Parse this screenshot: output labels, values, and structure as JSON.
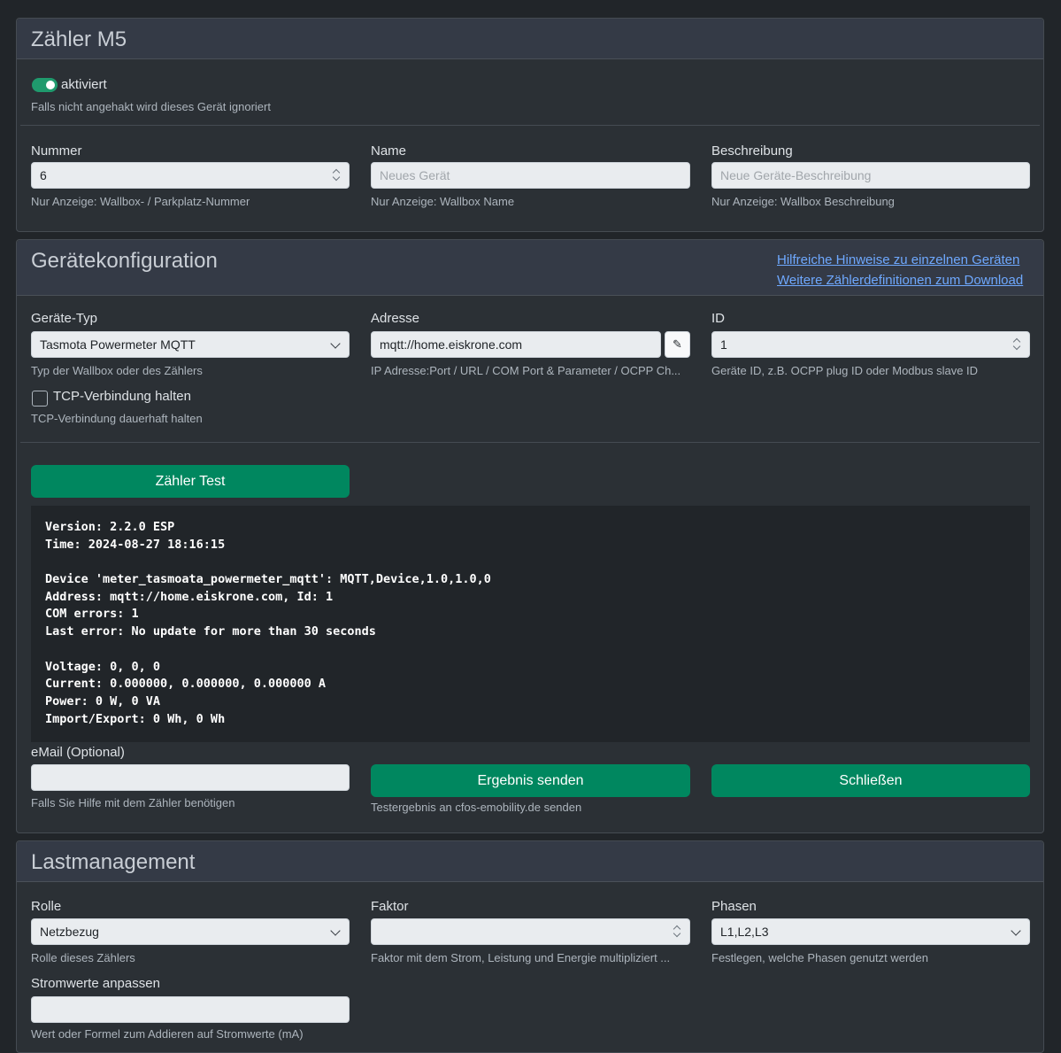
{
  "card1": {
    "title": "Zähler M5",
    "toggle_label": "aktiviert",
    "toggle_help": "Falls nicht angehakt wird dieses Gerät ignoriert",
    "nummer": {
      "label": "Nummer",
      "value": "6",
      "help": "Nur Anzeige: Wallbox- / Parkplatz-Nummer"
    },
    "name": {
      "label": "Name",
      "placeholder": "Neues Gerät",
      "help": "Nur Anzeige: Wallbox Name"
    },
    "beschreibung": {
      "label": "Beschreibung",
      "placeholder": "Neue Geräte-Beschreibung",
      "help": "Nur Anzeige: Wallbox Beschreibung"
    }
  },
  "card2": {
    "title": "Gerätekonfiguration",
    "link1": "Hilfreiche Hinweise zu einzelnen Geräten",
    "link2": "Weitere Zählerdefinitionen zum Download",
    "typ": {
      "label": "Geräte-Typ",
      "value": "Tasmota Powermeter MQTT",
      "help": "Typ der Wallbox oder des Zählers"
    },
    "adresse": {
      "label": "Adresse",
      "value": "mqtt://home.eiskrone.com",
      "help": "IP Adresse:Port / URL / COM Port & Parameter / OCPP Ch...",
      "edit_icon": "✎"
    },
    "id": {
      "label": "ID",
      "value": "1",
      "help": "Geräte ID, z.B. OCPP plug ID oder Modbus slave ID"
    },
    "tcp": {
      "label": "TCP-Verbindung halten",
      "help": "TCP-Verbindung dauerhaft halten"
    },
    "test_button": "Zähler Test",
    "console": [
      "Version: 2.2.0 ESP",
      "Time: 2024-08-27 18:16:15",
      "",
      "Device 'meter_tasmoata_powermeter_mqtt': MQTT,Device,1.0,1.0,0",
      "Address: mqtt://home.eiskrone.com, Id: 1",
      "COM errors: 1",
      "Last error: No update for more than 30 seconds",
      "",
      "Voltage: 0, 0, 0",
      "Current: 0.000000, 0.000000, 0.000000 A",
      "Power: 0 W, 0 VA",
      "Import/Export: 0 Wh, 0 Wh"
    ],
    "email": {
      "label": "eMail (Optional)",
      "value": "",
      "help": "Falls Sie Hilfe mit dem Zähler benötigen"
    },
    "send_button": "Ergebnis senden",
    "send_help": "Testergebnis an cfos-emobility.de senden",
    "close_button": "Schließen"
  },
  "card3": {
    "title": "Lastmanagement",
    "rolle": {
      "label": "Rolle",
      "value": "Netzbezug",
      "help": "Rolle dieses Zählers"
    },
    "faktor": {
      "label": "Faktor",
      "value": "",
      "help": "Faktor mit dem Strom, Leistung und Energie multipliziert ..."
    },
    "phasen": {
      "label": "Phasen",
      "value": "L1,L2,L3",
      "help": "Festlegen, welche Phasen genutzt werden"
    },
    "strom": {
      "label": "Stromwerte anpassen",
      "value": "",
      "help": "Wert oder Formel zum Addieren auf Stromwerte (mA)"
    }
  },
  "colors": {
    "accent": "#00875f",
    "link": "#6ea8fe",
    "background": "#212529",
    "card": "#2b3035"
  }
}
